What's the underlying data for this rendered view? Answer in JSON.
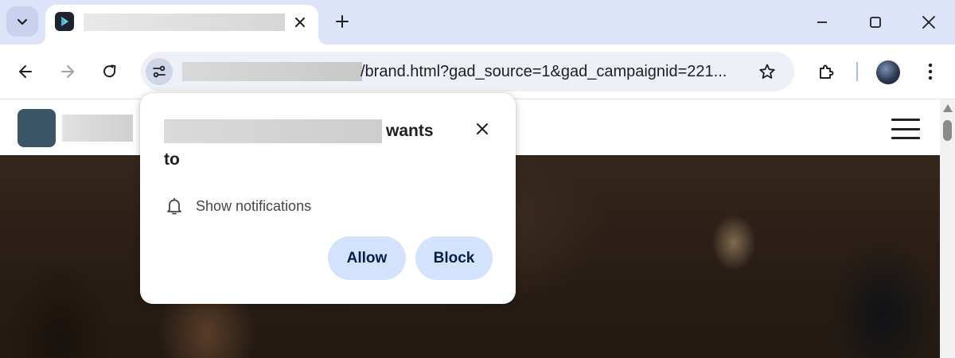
{
  "browser": {
    "tab_title": "",
    "url_host": "",
    "url_path": "/brand.html?gad_source=1&gad_campaignid=221..."
  },
  "permission_prompt": {
    "site_name": "",
    "title_suffix": "wants",
    "title_line2": "to",
    "permission_label": "Show notifications",
    "allow_label": "Allow",
    "block_label": "Block"
  },
  "colors": {
    "tabstrip": "#dde3f9",
    "button_bg": "#d3e3fd",
    "button_text": "#041e49"
  }
}
